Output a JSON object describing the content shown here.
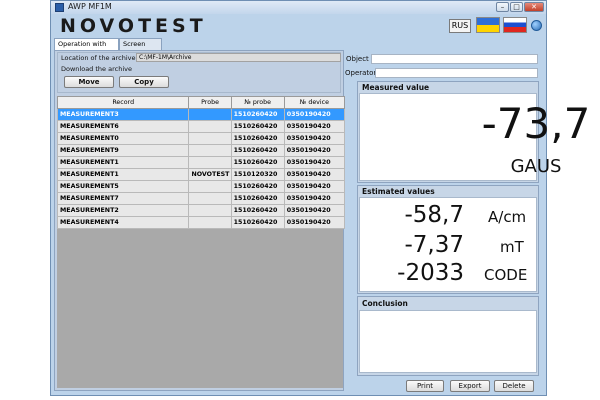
{
  "window": {
    "title": "AWP MF1M",
    "min": "–",
    "max": "□",
    "close": "✕"
  },
  "header": {
    "logo": "NOVOTEST",
    "lang": "RUS"
  },
  "tabs": [
    "Operation with archive",
    "Screen copies"
  ],
  "archive": {
    "location_label": "Location of the archive",
    "location_value": "C:\\MF-1M\\Archive",
    "download_label": "Download the archive",
    "move_label": "Move",
    "copy_label": "Copy"
  },
  "table": {
    "columns": [
      "Record",
      "Probe",
      "№ probe",
      "№ device"
    ],
    "rows": [
      [
        "MEASUREMENT3",
        "",
        "1510260420",
        "0350190420"
      ],
      [
        "MEASUREMENT6",
        "",
        "1510260420",
        "0350190420"
      ],
      [
        "MEASUREMENT0",
        "",
        "1510260420",
        "0350190420"
      ],
      [
        "MEASUREMENT9",
        "",
        "1510260420",
        "0350190420"
      ],
      [
        "MEASUREMENT1",
        "",
        "1510260420",
        "0350190420"
      ],
      [
        "MEASUREMENT1",
        "NOVOTEST",
        "1510120320",
        "0350190420"
      ],
      [
        "MEASUREMENT5",
        "",
        "1510260420",
        "0350190420"
      ],
      [
        "MEASUREMENT7",
        "",
        "1510260420",
        "0350190420"
      ],
      [
        "MEASUREMENT2",
        "",
        "1510260420",
        "0350190420"
      ],
      [
        "MEASUREMENT4",
        "",
        "1510260420",
        "0350190420"
      ]
    ],
    "selected_index": 0
  },
  "right": {
    "object_label": "Object",
    "operator_label": "Operator",
    "measured_title": "Measured value",
    "measured_value": "-73,7",
    "measured_unit": "GAUS",
    "estimated_title": "Estimated values",
    "estimated": [
      {
        "value": "-58,7",
        "unit": "A/cm"
      },
      {
        "value": "-7,37",
        "unit": "mT"
      },
      {
        "value": "-2033",
        "unit": "CODE"
      }
    ],
    "conclusion_title": "Conclusion"
  },
  "buttons": {
    "print": "Print",
    "export": "Export",
    "delete": "Delete"
  }
}
